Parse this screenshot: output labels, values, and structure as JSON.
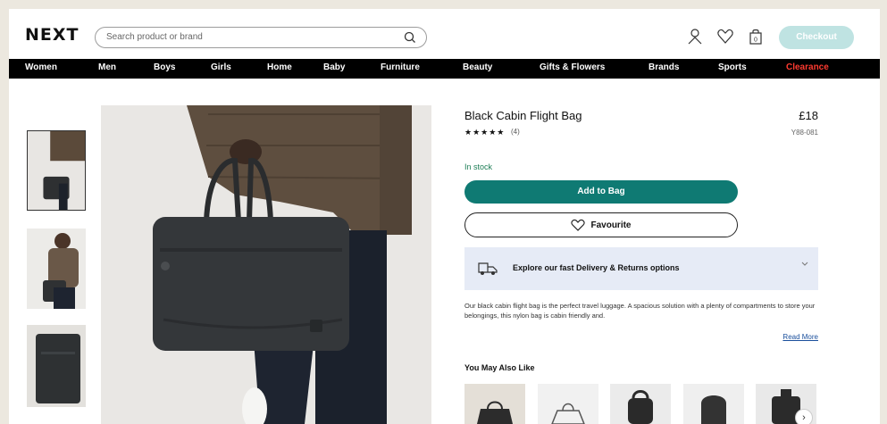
{
  "header": {
    "logo": "NEXT",
    "search_placeholder": "Search product or brand",
    "icons": [
      "account-icon",
      "heart-icon",
      "bag-icon"
    ],
    "bag_count": "0",
    "checkout_label": "Checkout"
  },
  "nav": {
    "items": [
      "Women",
      "Men",
      "Boys",
      "Girls",
      "Home",
      "Baby",
      "Furniture",
      "Beauty",
      "Gifts & Flowers",
      "Brands",
      "Sports",
      "Clearance"
    ],
    "highlight_color": "#ff3b30"
  },
  "product": {
    "title": "Black Cabin Flight Bag",
    "price": "£18",
    "rating_stars": "★★★★★",
    "rating_value": 4.5,
    "review_count": "(4)",
    "item_code": "Y88-081",
    "stock_status": "In stock",
    "add_to_bag_label": "Add to Bag",
    "favourite_label": "Favourite",
    "delivery_label": "Explore our fast Delivery & Returns options",
    "description": "Our black cabin flight bag is the perfect travel luggage. A spacious solution with a plenty of compartments to store your belongings, this nylon bag is cabin friendly and.",
    "read_more_label": "Read More",
    "also_like_label": "You May Also Like"
  },
  "colors": {
    "accent": "#0f7a73",
    "checkout_bg": "#bfe3e2",
    "stock_text": "#1c7d55",
    "delivery_bg": "#e6ebf6"
  }
}
